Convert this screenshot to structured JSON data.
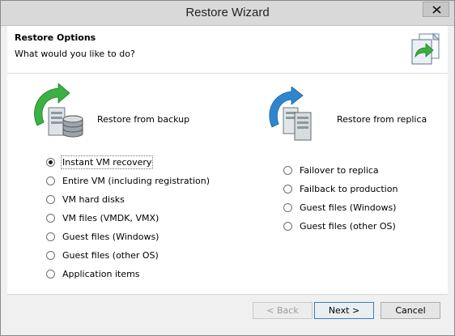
{
  "window": {
    "title": "Restore Wizard"
  },
  "header": {
    "title": "Restore Options",
    "subtitle": "What would you like to do?"
  },
  "backup_group": {
    "label": "Restore from backup",
    "options": [
      {
        "label": "Instant VM recovery",
        "checked": true
      },
      {
        "label": "Entire VM (including registration)",
        "checked": false
      },
      {
        "label": "VM hard disks",
        "checked": false
      },
      {
        "label": "VM files (VMDK, VMX)",
        "checked": false
      },
      {
        "label": "Guest files (Windows)",
        "checked": false
      },
      {
        "label": "Guest files (other OS)",
        "checked": false
      },
      {
        "label": "Application items",
        "checked": false
      }
    ]
  },
  "replica_group": {
    "label": "Restore from replica",
    "options": [
      {
        "label": "Failover to replica",
        "checked": false
      },
      {
        "label": "Failback to production",
        "checked": false
      },
      {
        "label": "Guest files (Windows)",
        "checked": false
      },
      {
        "label": "Guest files (other OS)",
        "checked": false
      }
    ]
  },
  "buttons": {
    "back": "< Back",
    "next": "Next >",
    "cancel": "Cancel"
  },
  "colors": {
    "accent_green": "#2faa3a",
    "accent_blue": "#2f7fc8"
  }
}
